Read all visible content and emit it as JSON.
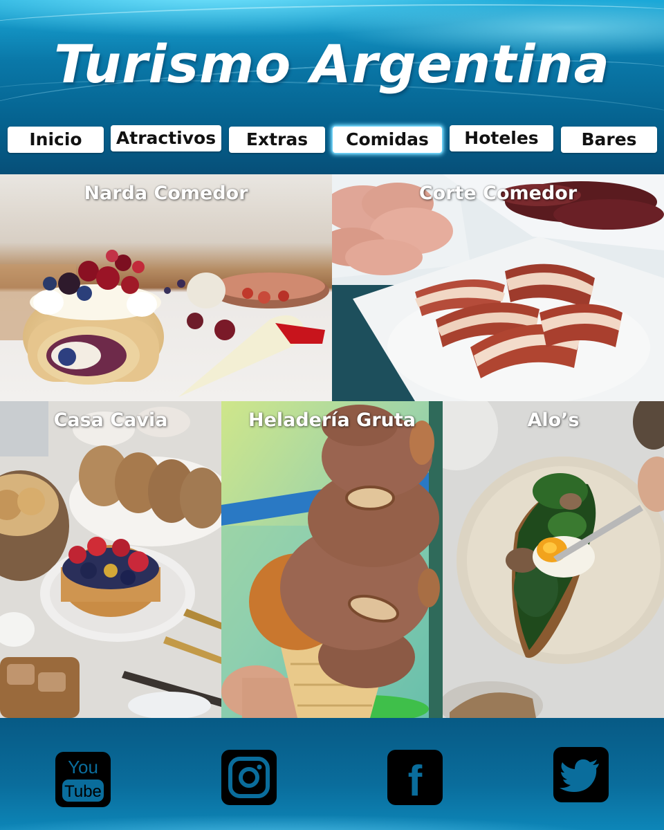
{
  "header": {
    "title": "Turismo Argentina",
    "nav": [
      {
        "label": "Inicio",
        "active": false
      },
      {
        "label": "Atractivos",
        "active": false
      },
      {
        "label": "Extras",
        "active": false
      },
      {
        "label": "Comidas",
        "active": true
      },
      {
        "label": "Hoteles",
        "active": false
      },
      {
        "label": "Bares",
        "active": false
      }
    ]
  },
  "restaurants": [
    {
      "name": "Narda Comedor",
      "photo": "swiss-roll-cake-with-berries"
    },
    {
      "name": "Corte Comedor",
      "photo": "cured-meats-and-bacon-plate"
    },
    {
      "name": "Casa Cavia",
      "photo": "berry-tart-and-bread"
    },
    {
      "name": "Heladería Gruta",
      "photo": "chocolate-ice-cream-cone"
    },
    {
      "name": "Alo’s",
      "photo": "spinach-and-egg-toast"
    }
  ],
  "footer": {
    "social": [
      {
        "icon": "youtube-icon",
        "text": [
          "You",
          "Tube"
        ]
      },
      {
        "icon": "instagram-icon"
      },
      {
        "icon": "facebook-icon",
        "text": [
          "f"
        ]
      },
      {
        "icon": "twitter-icon"
      }
    ]
  },
  "colors": {
    "header_top": "#1aa8d8",
    "header_bottom": "#064f78",
    "nav_active_glow": "#6fd4ff",
    "footer": "#0a6d9c",
    "social_bg": "#000000"
  }
}
